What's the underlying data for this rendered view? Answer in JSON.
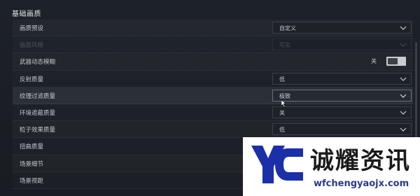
{
  "section": {
    "title": "基础画质"
  },
  "rows": [
    {
      "label": "画质预设",
      "control": "dropdown",
      "value": "自定义"
    },
    {
      "label": "画面风格",
      "control": "dropdown",
      "value": "写实",
      "disabled": true
    },
    {
      "label": "武器动态模糊",
      "control": "toggle",
      "toggle_text": "关",
      "on": false
    },
    {
      "label": "反射质量",
      "control": "dropdown",
      "value": "低"
    },
    {
      "label": "纹理过滤质量",
      "control": "dropdown",
      "value": "极致",
      "highlighted": true
    },
    {
      "label": "环境遮蔽质量",
      "control": "dropdown",
      "value": "关"
    },
    {
      "label": "粒子效果质量",
      "control": "dropdown",
      "value": "低"
    },
    {
      "label": "扭曲质量",
      "control": "dropdown",
      "value": ""
    },
    {
      "label": "场景细节",
      "control": "dropdown",
      "value": ""
    },
    {
      "label": "场景视距",
      "control": "dropdown",
      "value": ""
    }
  ],
  "watermark": {
    "name": "诚耀资讯",
    "url": "wfchengyaojx.com",
    "brand_color": "#1b2fa8"
  },
  "colors": {
    "background": "#1b1f25",
    "highlight_row": "#2b3038"
  }
}
